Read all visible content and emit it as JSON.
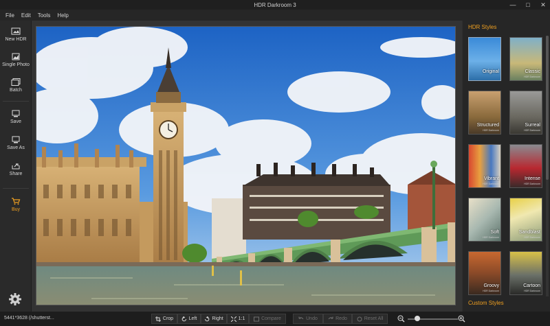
{
  "window": {
    "title": "HDR Darkroom 3"
  },
  "menu": [
    "File",
    "Edit",
    "Tools",
    "Help"
  ],
  "sidebar": {
    "new_hdr": "New HDR",
    "single_photo": "Single Photo",
    "batch": "Batch",
    "save": "Save",
    "save_as": "Save As",
    "share": "Share",
    "buy": "Buy"
  },
  "panel": {
    "title": "HDR Styles",
    "custom": "Custom Styles",
    "subtitle": "HDR Darkroom",
    "styles": [
      "Original",
      "Classic",
      "Structured",
      "Surreal",
      "Vibrant",
      "Intense",
      "Soft",
      "Sandblast",
      "Groovy",
      "Cartoon"
    ]
  },
  "status": {
    "info": "5441*3628 (/shutterst..."
  },
  "toolbar": {
    "crop": "Crop",
    "left": "Left",
    "right": "Right",
    "one_to_one": "1:1",
    "compare": "Compare",
    "undo": "Undo",
    "redo": "Redo",
    "reset_all": "Reset All"
  },
  "zoom": {
    "level": 0.15
  },
  "colors": {
    "accent": "#f0a020"
  }
}
